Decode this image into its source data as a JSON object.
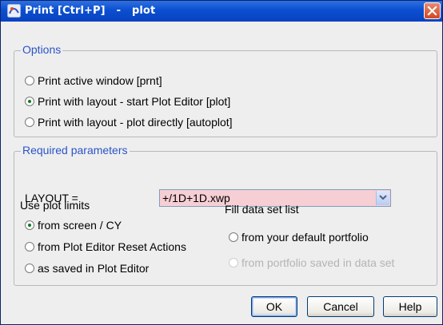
{
  "window": {
    "title": "Print [Ctrl+P]   -   plot",
    "colors": {
      "titlebar": "#0a4fd0",
      "group_title": "#2a54c8",
      "combo_bg": "#f6cfd4"
    }
  },
  "options": {
    "legend": "Options",
    "items": [
      {
        "label": "Print active window [prnt]",
        "checked": false
      },
      {
        "label": "Print with layout - start Plot Editor [plot]",
        "checked": true
      },
      {
        "label": "Print with layout - plot directly [autoplot]",
        "checked": false
      }
    ]
  },
  "required": {
    "legend": "Required parameters",
    "layout_label": "LAYOUT =",
    "layout_value": "+/1D+1D.xwp",
    "plot_limits_label": "Use plot limits",
    "plot_limits": [
      {
        "label": "from screen / CY",
        "checked": true
      },
      {
        "label": "from Plot Editor Reset Actions",
        "checked": false
      },
      {
        "label": "as saved in Plot Editor",
        "checked": false
      }
    ],
    "fill_label": "Fill data set list",
    "fill_options": [
      {
        "label": "from your default portfolio",
        "checked": false,
        "disabled": false
      },
      {
        "label": "from portfolio saved in data set",
        "checked": false,
        "disabled": true
      }
    ]
  },
  "buttons": {
    "ok": "OK",
    "cancel": "Cancel",
    "help": "Help"
  },
  "icons": {
    "app": "topspin-app-icon",
    "close": "close-icon",
    "dropdown": "chevron-down-icon"
  }
}
